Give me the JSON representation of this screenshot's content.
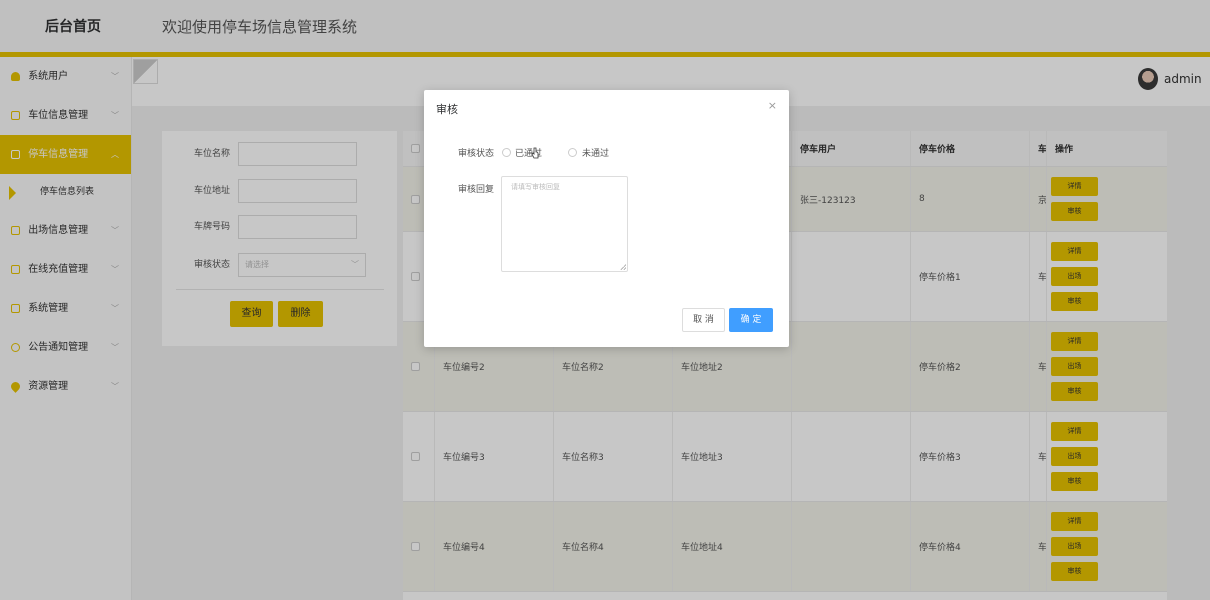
{
  "header": {
    "brand": "后台首页",
    "title": "欢迎使用停车场信息管理系统",
    "user": "admin"
  },
  "sidebar": {
    "items": [
      {
        "label": "系统用户"
      },
      {
        "label": "车位信息管理"
      },
      {
        "label": "停车信息管理"
      },
      {
        "label": "停车信息列表"
      },
      {
        "label": "出场信息管理"
      },
      {
        "label": "在线充值管理"
      },
      {
        "label": "系统管理"
      },
      {
        "label": "公告通知管理"
      },
      {
        "label": "资源管理"
      }
    ]
  },
  "search": {
    "fields": [
      "车位名称",
      "车位地址",
      "车牌号码",
      "审核状态"
    ],
    "status_placeholder": "请选择",
    "query_btn": "查询",
    "delete_btn": "删除"
  },
  "table": {
    "headers": [
      "停车用户",
      "停车价格",
      "车辆",
      "操作"
    ],
    "rows": [
      {
        "col1": "",
        "col2": "",
        "col3": "",
        "user": "张三-123123",
        "price": "8",
        "car": "京A",
        "ops": [
          "详情",
          "审核"
        ]
      },
      {
        "col1": "",
        "col2": "",
        "col3": "",
        "user": "",
        "price": "停车价格1",
        "car": "车辆",
        "ops": [
          "详情",
          "出场",
          "审核"
        ]
      },
      {
        "col1": "车位编号2",
        "col2": "车位名称2",
        "col3": "车位地址2",
        "user": "",
        "price": "停车价格2",
        "car": "车辆",
        "ops": [
          "详情",
          "出场",
          "审核"
        ]
      },
      {
        "col1": "车位编号3",
        "col2": "车位名称3",
        "col3": "车位地址3",
        "user": "",
        "price": "停车价格3",
        "car": "车辆",
        "ops": [
          "详情",
          "出场",
          "审核"
        ]
      },
      {
        "col1": "车位编号4",
        "col2": "车位名称4",
        "col3": "车位地址4",
        "user": "",
        "price": "停车价格4",
        "car": "车辆",
        "ops": [
          "详情",
          "出场",
          "审核"
        ]
      }
    ]
  },
  "dialog": {
    "title": "审核",
    "close": "×",
    "status_label": "审核状态",
    "option_pass": "已通过",
    "option_fail": "未通过",
    "reply_label": "审核回复",
    "reply_placeholder": "请填写审核回复",
    "cancel": "取 消",
    "confirm": "确 定"
  },
  "colors": {
    "accent": "#e6c200",
    "primary": "#409eff"
  }
}
